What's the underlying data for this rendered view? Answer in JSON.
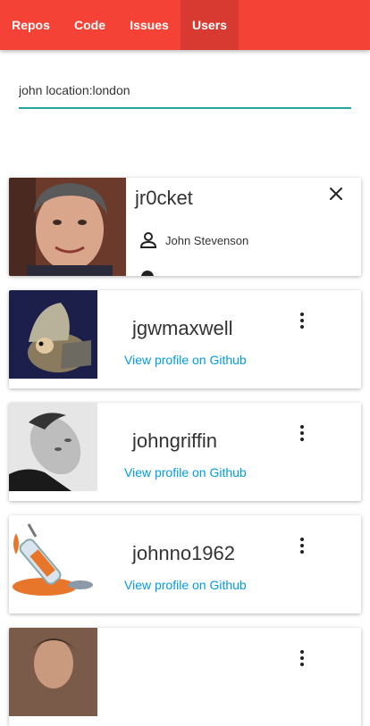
{
  "tabs": [
    {
      "label": "Repos",
      "active": false
    },
    {
      "label": "Code",
      "active": false
    },
    {
      "label": "Issues",
      "active": false
    },
    {
      "label": "Users",
      "active": true
    }
  ],
  "search": {
    "value": "john location:london"
  },
  "users": [
    {
      "username": "jr0cket",
      "full_name": "John Stevenson",
      "expanded": true
    },
    {
      "username": "jgwmaxwell",
      "link": "View profile on Github"
    },
    {
      "username": "johngriffin",
      "link": "View profile on Github"
    },
    {
      "username": "johnno1962",
      "link": "View profile on Github"
    },
    {
      "username": "",
      "link": ""
    }
  ],
  "colors": {
    "appbar": "#f44336",
    "active_tab": "#d83a31",
    "accent": "#26a69a",
    "link": "#039be5"
  },
  "icons": [
    "close-icon",
    "person-icon",
    "more-vert-icon"
  ]
}
